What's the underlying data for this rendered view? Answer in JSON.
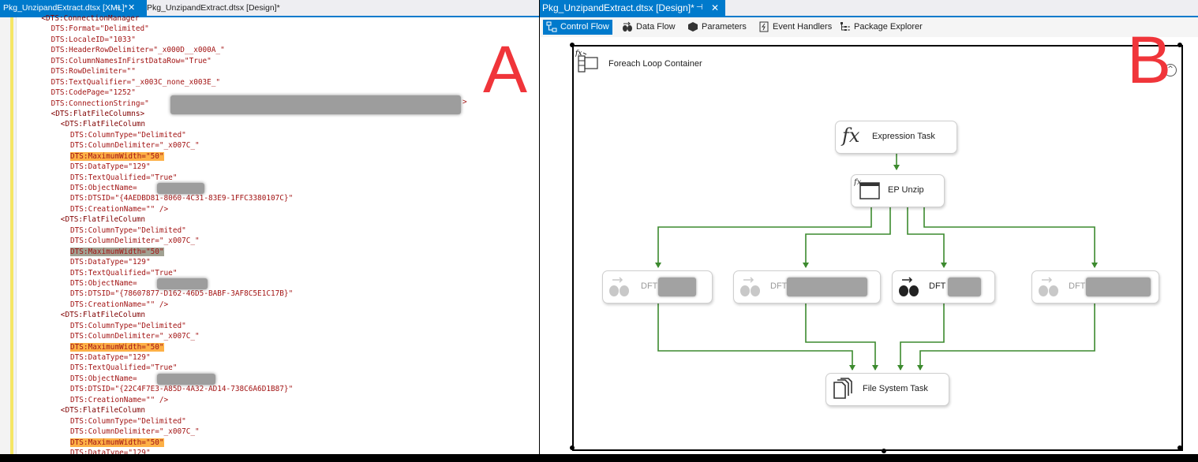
{
  "left_pane": {
    "tabs": [
      {
        "label": "Pkg_UnzipandExtract.dtsx [XML]*",
        "active": true
      },
      {
        "label": "Pkg_UnzipandExtract.dtsx [Design]*",
        "active": false
      }
    ],
    "pin_glyph": "⊣",
    "close_glyph": "✕",
    "annotation_letter": "A",
    "code_lines": [
      "    <DTS:ConnectionManager",
      "      DTS:Format=\"Delimited\"",
      "      DTS:LocaleID=\"1033\"",
      "      DTS:HeaderRowDelimiter=\"_x000D__x000A_\"",
      "      DTS:ColumnNamesInFirstDataRow=\"True\"",
      "      DTS:RowDelimiter=\"\"",
      "      DTS:TextQualifier=\"_x003C_none_x003E_\"",
      "      DTS:CodePage=\"1252\"",
      "      DTS:ConnectionString=\"",
      "      <DTS:FlatFileColumns>",
      "        <DTS:FlatFileColumn",
      "          DTS:ColumnType=\"Delimited\"",
      "          DTS:ColumnDelimiter=\"_x007C_\"",
      "          DTS:MaximumWidth=\"50\"",
      "          DTS:DataType=\"129\"",
      "          DTS:TextQualified=\"True\"",
      "          DTS:ObjectName=",
      "          DTS:DTSID=\"{4AEDBD81-8060-4C31-83E9-1FFC3380107C}\"",
      "          DTS:CreationName=\"\" />",
      "        <DTS:FlatFileColumn",
      "          DTS:ColumnType=\"Delimited\"",
      "          DTS:ColumnDelimiter=\"_x007C_\"",
      "          DTS:MaximumWidth=\"50\"",
      "          DTS:DataType=\"129\"",
      "          DTS:TextQualified=\"True\"",
      "          DTS:ObjectName=",
      "          DTS:DTSID=\"{78607877-D162-46D5-BABF-3AF8C5E1C17B}\"",
      "          DTS:CreationName=\"\" />",
      "        <DTS:FlatFileColumn",
      "          DTS:ColumnType=\"Delimited\"",
      "          DTS:ColumnDelimiter=\"_x007C_\"",
      "          DTS:MaximumWidth=\"50\"",
      "          DTS:DataType=\"129\"",
      "          DTS:TextQualified=\"True\"",
      "          DTS:ObjectName=",
      "          DTS:DTSID=\"{22C4F7E3-A85D-4A32-AD14-738C6A6D1B87}\"",
      "          DTS:CreationName=\"\" />",
      "        <DTS:FlatFileColumn",
      "          DTS:ColumnType=\"Delimited\"",
      "          DTS:ColumnDelimiter=\"_x007C_\"",
      "          DTS:MaximumWidth=\"50\"",
      "          DTS:DataType=\"129\""
    ],
    "highlight_orange_lines": [
      13,
      31,
      40
    ],
    "highlight_gray_lines": [
      22
    ],
    "tag_lines": [
      0,
      9,
      10,
      19,
      28,
      37
    ],
    "connection_string_close": ">"
  },
  "right_pane": {
    "tab": {
      "label": "Pkg_UnzipandExtract.dtsx [Design]*",
      "pin_glyph": "⊣",
      "close_glyph": "✕"
    },
    "designer_tabs": [
      {
        "label": "Control Flow",
        "icon": "control-flow-icon",
        "active": true
      },
      {
        "label": "Data Flow",
        "icon": "data-flow-icon",
        "active": false
      },
      {
        "label": "Parameters",
        "icon": "parameters-icon",
        "active": false
      },
      {
        "label": "Event Handlers",
        "icon": "event-handlers-icon",
        "active": false
      },
      {
        "label": "Package Explorer",
        "icon": "package-explorer-icon",
        "active": false
      }
    ],
    "annotation_letter": "B",
    "container": {
      "title": "Foreach Loop Container",
      "collapse_glyph": "^"
    },
    "tasks": {
      "expression": {
        "label": "Expression Task",
        "icon_text": "fx"
      },
      "ep_unzip": {
        "label": "EP Unzip",
        "badge": "fx"
      },
      "dft1": {
        "label": "DFT",
        "disabled": true
      },
      "dft2": {
        "label": "DFT",
        "disabled": true
      },
      "dft3": {
        "label": "DFT",
        "disabled": false
      },
      "dft4": {
        "label": "DFT",
        "disabled": true
      },
      "file_system": {
        "label": "File System Task"
      }
    },
    "flow_color": "#3c8a2e"
  }
}
